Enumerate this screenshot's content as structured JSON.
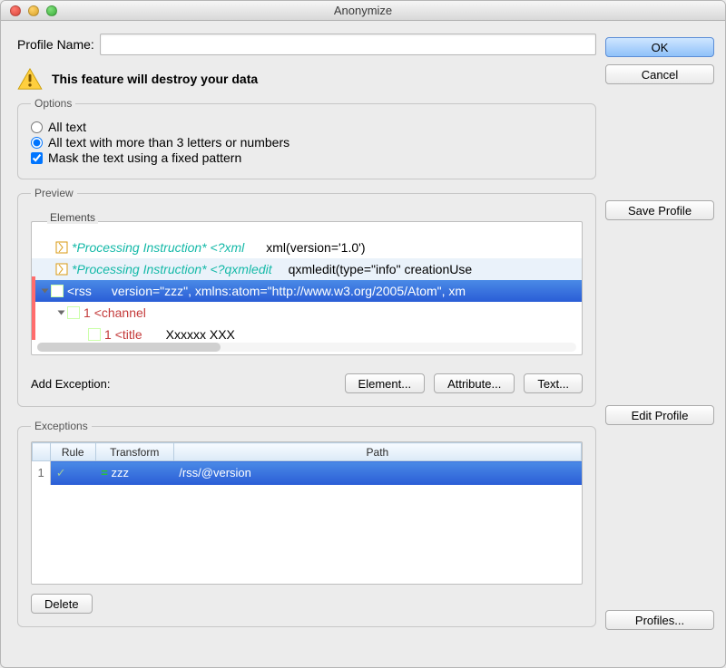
{
  "window_title": "Anonymize",
  "profile_name": {
    "label": "Profile Name:",
    "value": ""
  },
  "warning_text": "This feature will destroy your data",
  "options": {
    "legend": "Options",
    "opt_all_text": "All text",
    "opt_more_than_3": "All text with more than 3 letters or numbers",
    "opt_mask_fixed": "Mask the text using a fixed pattern"
  },
  "preview": {
    "legend": "Preview",
    "elements_legend": "Elements",
    "rows": {
      "r1": {
        "pi": "*Processing Instruction* <?xml",
        "rest": "xml(version='1.0')"
      },
      "r2": {
        "pi": "*Processing Instruction* <?qxmledit",
        "rest": "qxmledit(type=\"info\"   creationUse"
      },
      "r3": {
        "name": "<rss",
        "attrs": "version=\"zzz\", xmlns:atom=\"http://www.w3.org/2005/Atom\", xm"
      },
      "r4": {
        "num": "1",
        "name": "<channel"
      },
      "r5": {
        "num": "1",
        "name": "<title",
        "text": "Xxxxxx XXX"
      }
    },
    "add_exception_label": "Add Exception:",
    "buttons": {
      "element": "Element...",
      "attribute": "Attribute...",
      "text": "Text..."
    }
  },
  "exceptions": {
    "legend": "Exceptions",
    "headers": {
      "rule": "Rule",
      "transform": "Transform",
      "path": "Path"
    },
    "row1": {
      "index": "1",
      "transform": "zzz",
      "path": "/rss/@version"
    },
    "delete_label": "Delete"
  },
  "side": {
    "ok": "OK",
    "cancel": "Cancel",
    "save_profile": "Save Profile",
    "edit_profile": "Edit Profile",
    "profiles": "Profiles..."
  }
}
